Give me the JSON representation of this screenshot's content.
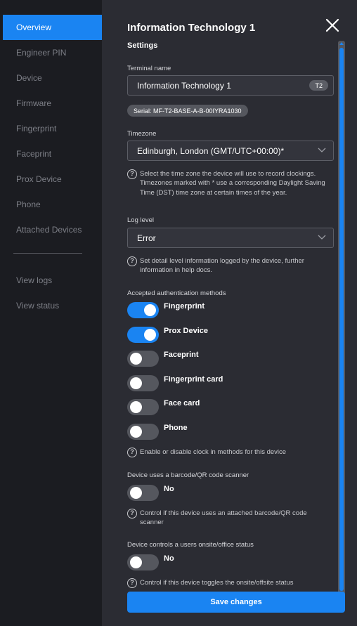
{
  "sidebar": {
    "items": [
      {
        "label": "Overview",
        "active": true
      },
      {
        "label": "Engineer PIN"
      },
      {
        "label": "Device"
      },
      {
        "label": "Firmware"
      },
      {
        "label": "Fingerprint"
      },
      {
        "label": "Faceprint"
      },
      {
        "label": "Prox Device"
      },
      {
        "label": "Phone"
      },
      {
        "label": "Attached Devices"
      }
    ],
    "secondary": [
      {
        "label": "View logs"
      },
      {
        "label": "View status"
      }
    ]
  },
  "panel": {
    "title": "Information Technology 1",
    "section_title": "Settings",
    "terminal_name": {
      "label": "Terminal name",
      "value": "Information Technology 1",
      "badge": "T2"
    },
    "serial": "Serial: MF-T2-BASE-A-B-00IYRA1030",
    "timezone": {
      "label": "Timezone",
      "value": "Edinburgh, London (GMT/UTC+00:00)*",
      "help": "Select the time zone the device will use to record clockings. Timezones marked with * use a corresponding Daylight Saving Time (DST) time zone at certain times of the year."
    },
    "log_level": {
      "label": "Log level",
      "value": "Error",
      "help": "Set detail level information logged by the device, further information in help docs."
    },
    "auth_methods": {
      "label": "Accepted authentication methods",
      "items": [
        {
          "label": "Fingerprint",
          "on": true
        },
        {
          "label": "Prox Device",
          "on": true
        },
        {
          "label": "Faceprint",
          "on": false
        },
        {
          "label": "Fingerprint card",
          "on": false
        },
        {
          "label": "Face card",
          "on": false
        },
        {
          "label": "Phone",
          "on": false
        }
      ],
      "help": "Enable or disable clock in methods for this device"
    },
    "barcode": {
      "label": "Device uses a barcode/QR code scanner",
      "value": "No",
      "on": false,
      "help": "Control if this device uses an attached barcode/QR code scanner"
    },
    "onsite": {
      "label": "Device controls a users onsite/office status",
      "value": "No",
      "on": false,
      "help": "Control if this device toggles the onsite/offsite status"
    },
    "save_label": "Save changes"
  },
  "colors": {
    "accent": "#1a84f2",
    "panel_bg": "#2b2c33",
    "sidebar_bg": "#1b1c21"
  }
}
